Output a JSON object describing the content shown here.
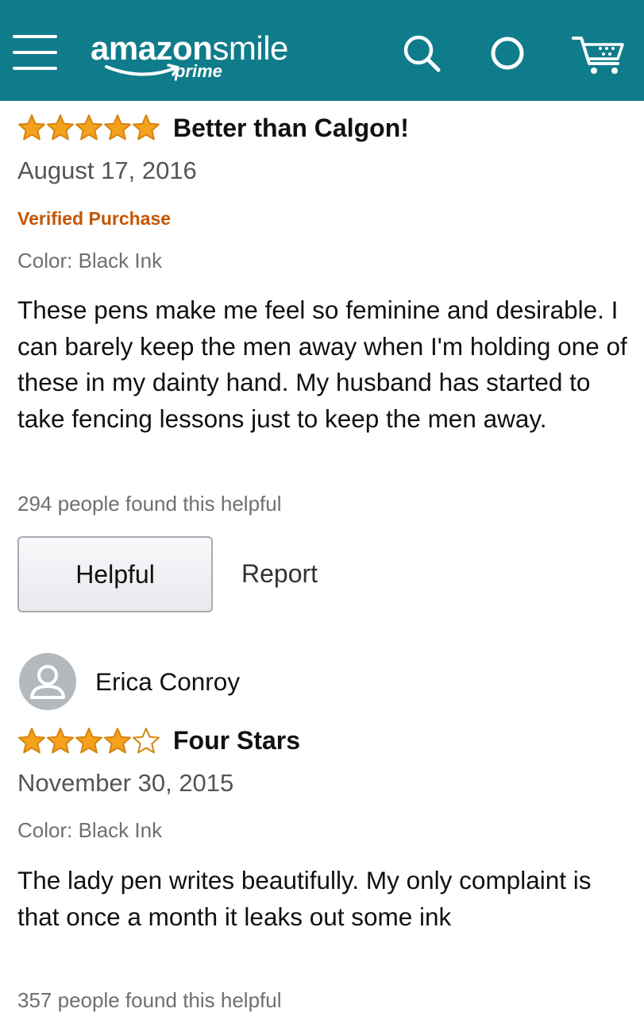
{
  "header": {
    "logo_amazon": "amazon",
    "logo_smile": "smile",
    "logo_prime": "prime",
    "icons": [
      "menu-icon",
      "search-icon",
      "alexa-icon",
      "cart-icon"
    ],
    "background_color": "#0f7c8c"
  },
  "colors": {
    "star_fill": "#f4a11d",
    "star_stroke": "#d68410",
    "verified": "#c45500",
    "muted_text": "#6f6f6f"
  },
  "reviews": [
    {
      "rating": 5,
      "rating_max": 5,
      "title": "Better than Calgon!",
      "date": "August 17, 2016",
      "verified": "Verified Purchase",
      "variant": "Color: Black Ink",
      "body": "These pens make me feel so feminine and desirable. I can barely keep the men away when I'm holding one of these in my dainty hand. My husband has started to take fencing lessons just to keep the men away.",
      "helpful_count": "294 people found this helpful",
      "helpful_button": "Helpful",
      "report_link": "Report"
    },
    {
      "reviewer_name": "Erica Conroy",
      "rating": 4,
      "rating_max": 5,
      "title": "Four Stars",
      "date": "November 30, 2015",
      "variant": "Color: Black Ink",
      "body": "The lady pen writes beautifully. My only complaint is that once a month it leaks out some ink",
      "helpful_count": "357 people found this helpful"
    }
  ]
}
